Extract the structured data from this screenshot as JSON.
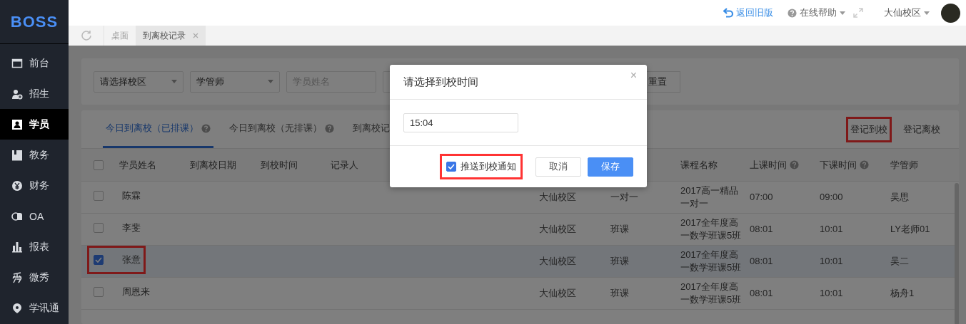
{
  "sidebar": {
    "logo": "BOSS",
    "items": [
      {
        "label": "前台",
        "selected": false
      },
      {
        "label": "招生",
        "selected": false
      },
      {
        "label": "学员",
        "selected": true
      },
      {
        "label": "教务",
        "selected": false
      },
      {
        "label": "财务",
        "selected": false
      },
      {
        "label": "OA",
        "selected": false
      },
      {
        "label": "报表",
        "selected": false
      },
      {
        "label": "微秀",
        "selected": false
      },
      {
        "label": "学讯通",
        "selected": false
      }
    ]
  },
  "header": {
    "back_link": "返回旧版",
    "help": "在线帮助",
    "campus": "大仙校区"
  },
  "page_tabs": [
    {
      "label": "桌面",
      "selected": false,
      "closable": false
    },
    {
      "label": "到离校记录",
      "selected": true,
      "closable": true
    }
  ],
  "filters": [
    {
      "kind": "select",
      "value": "请选择校区"
    },
    {
      "kind": "select",
      "value": "学管师"
    },
    {
      "kind": "input",
      "placeholder": "学员姓名"
    },
    {
      "kind": "input"
    }
  ],
  "reset_button": "重置",
  "list_tabs": [
    {
      "label": "今日到离校（已排课）",
      "help": true,
      "selected": true
    },
    {
      "label": "今日到离校（无排课）",
      "help": true,
      "selected": false
    },
    {
      "label": "到离校记",
      "help": false,
      "selected": false
    }
  ],
  "actions": [
    {
      "label": "登记到校",
      "highlighted": true
    },
    {
      "label": "登记离校",
      "highlighted": false
    }
  ],
  "table": {
    "all_checked": false,
    "columns": [
      {
        "label": "学员姓名",
        "help": false
      },
      {
        "label": "到离校日期",
        "help": false
      },
      {
        "label": "到校时间",
        "help": false
      },
      {
        "label": "记录人",
        "help": false
      },
      {
        "label": "课程名称",
        "help": false
      },
      {
        "label": "上课时间",
        "help": true
      },
      {
        "label": "下课时间",
        "help": true
      },
      {
        "label": "学管师",
        "help": false
      }
    ],
    "rows": [
      {
        "name": "陈霖",
        "column_5": "大仙校区",
        "column_6": "一对一",
        "course": "2017高一精品一对一",
        "start": "07:00",
        "end": "09:00",
        "manager": "吴思",
        "selected": false,
        "highlighted": false
      },
      {
        "name": "李斐",
        "column_5": "大仙校区",
        "column_6": "班课",
        "course": "2017全年度高一数学班课5班",
        "start": "08:01",
        "end": "10:01",
        "manager": "LY老师01",
        "selected": false,
        "highlighted": false
      },
      {
        "name": "张意",
        "column_5": "大仙校区",
        "column_6": "班课",
        "course": "2017全年度高一数学班课5班",
        "start": "08:01",
        "end": "10:01",
        "manager": "吴二",
        "selected": true,
        "highlighted": true
      },
      {
        "name": "周恩来",
        "column_5": "大仙校区",
        "column_6": "班课",
        "course": "2017全年度高一数学班课5班",
        "start": "08:01",
        "end": "10:01",
        "manager": "杨舟1",
        "selected": false,
        "highlighted": false
      }
    ]
  },
  "dialog": {
    "title": "请选择到校时间",
    "close": "×",
    "time": "15:04",
    "notify": {
      "label": "推送到校通知",
      "checked": true,
      "highlighted": true
    },
    "cancel": "取消",
    "save": "保存"
  }
}
